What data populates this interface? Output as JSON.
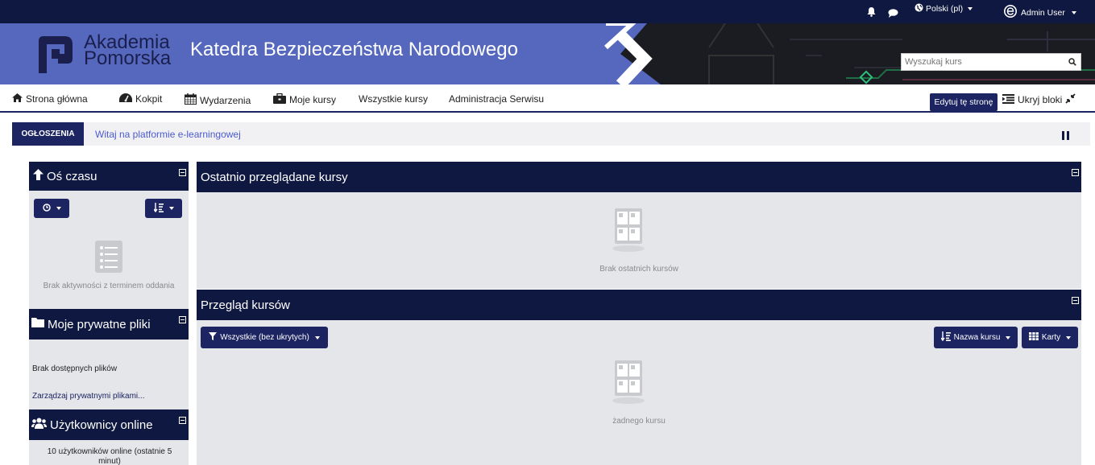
{
  "topbar": {
    "language": "Polski (pl)",
    "user": "Admin User",
    "icons": [
      "bell-icon",
      "chat-icon",
      "globe-icon",
      "user-avatar-icon"
    ]
  },
  "banner": {
    "logo_line1": "Akademia",
    "logo_line2": "Pomorska",
    "title": "Katedra Bezpieczeństwa Narodowego",
    "search_placeholder": "Wyszukaj kurs"
  },
  "nav": {
    "items": [
      {
        "label": "Strona główna",
        "icon": "home-icon"
      },
      {
        "label": "Kokpit",
        "icon": "dashboard-icon"
      },
      {
        "label": "Wydarzenia",
        "icon": "calendar-icon"
      },
      {
        "label": "Moje kursy",
        "icon": "briefcase-icon"
      },
      {
        "label": "Wszystkie kursy"
      },
      {
        "label": "Administracja Serwisu"
      }
    ],
    "edit_page": "Edytuj tę stronę",
    "hide_blocks": "Ukryj bloki"
  },
  "announcements": {
    "label": "OGŁOSZENIA",
    "text": "Witaj na platformie e-learningowej"
  },
  "left": {
    "timeline": {
      "title": "Oś czasu",
      "empty": "Brak aktywności z terminem oddania"
    },
    "files": {
      "title": "Moje prywatne pliki",
      "empty": "Brak dostępnych plików",
      "manage": "Zarządzaj prywatnymi plikami..."
    },
    "online": {
      "title": "Użytkownicy online",
      "text": "10 użytkowników online (ostatnie 5 minut)"
    }
  },
  "right": {
    "recent": {
      "title": "Ostatnio przeglądane kursy",
      "empty": "Brak ostatnich kursów"
    },
    "overview": {
      "title": "Przegląd kursów",
      "filter": "Wszystkie (bez ukrytych)",
      "sort": "Nazwa kursu",
      "view": "Karty",
      "empty": "żadnego kursu"
    }
  },
  "colors": {
    "navy": "#0f1840",
    "accent": "#1c2462",
    "banner": "#5568be",
    "panel": "#e5e6ea"
  }
}
